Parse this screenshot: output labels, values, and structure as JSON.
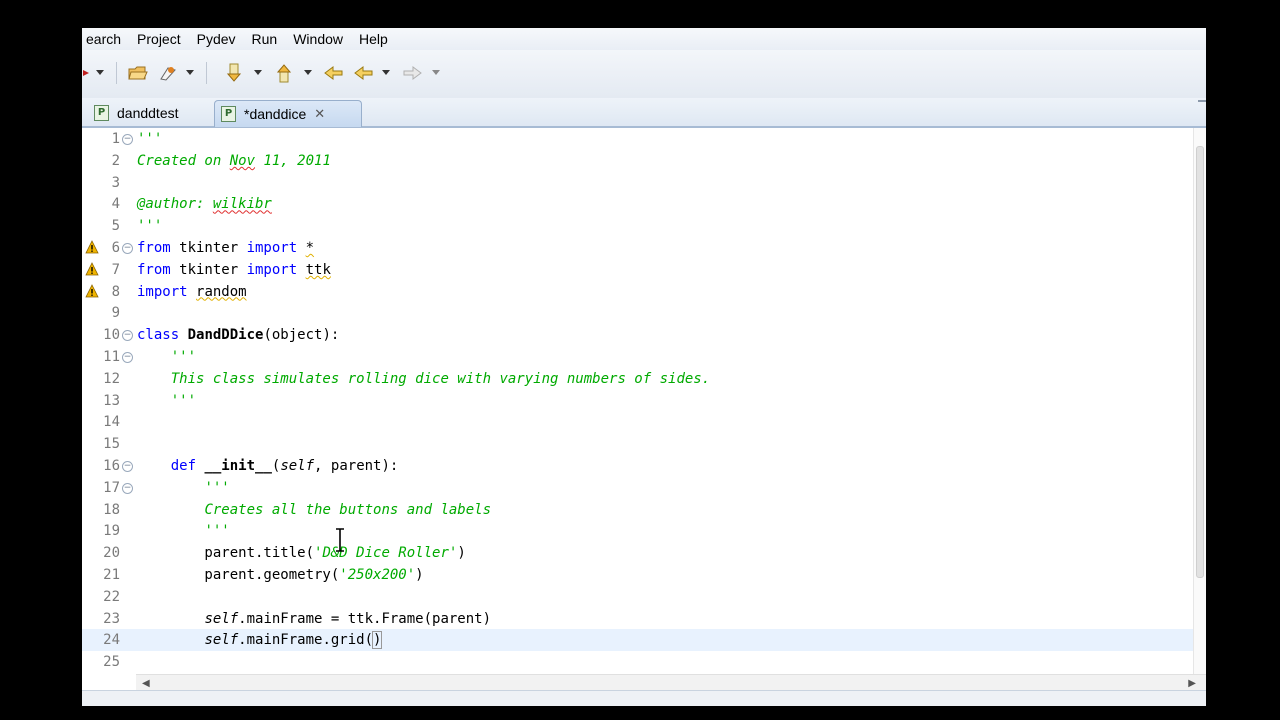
{
  "menu": [
    "earch",
    "Project",
    "Pydev",
    "Run",
    "Window",
    "Help"
  ],
  "tabs": [
    {
      "label": "danddtest",
      "icon": "pydev-file-icon",
      "active": false
    },
    {
      "label": "*danddice",
      "icon": "pydev-file-icon",
      "active": true
    }
  ],
  "tab_close_glyph": "✕",
  "colors": {
    "keyword": "#0000ff",
    "docstring": "#00aa00",
    "current_line": "#e8f2fe",
    "warning": "#f0b400"
  },
  "lines": [
    {
      "n": "1",
      "fold": true,
      "warn": false,
      "html": "<span class='doc'>'''</span>"
    },
    {
      "n": "2",
      "fold": false,
      "warn": false,
      "html": "<span class='doc'>Created on <span class='squig-red'>Nov</span> 11, 2011</span>"
    },
    {
      "n": "3",
      "fold": false,
      "warn": false,
      "html": ""
    },
    {
      "n": "4",
      "fold": false,
      "warn": false,
      "html": "<span class='doc'>@author: <span class='squig-red'>wilkibr</span></span>"
    },
    {
      "n": "5",
      "fold": false,
      "warn": false,
      "html": "<span class='doc'>'''</span>"
    },
    {
      "n": "6",
      "fold": true,
      "warn": true,
      "html": "<span class='kw'>from</span> tkinter <span class='kw'>import</span> <span class='squig'>*</span>"
    },
    {
      "n": "7",
      "fold": false,
      "warn": true,
      "html": "<span class='kw'>from</span> tkinter <span class='kw'>import</span> <span class='squig'>ttk</span>"
    },
    {
      "n": "8",
      "fold": false,
      "warn": true,
      "html": "<span class='kw'>import</span> <span class='squig'>random</span>"
    },
    {
      "n": "9",
      "fold": false,
      "warn": false,
      "html": ""
    },
    {
      "n": "10",
      "fold": true,
      "warn": false,
      "html": "<span class='kw'>class</span> <span class='cls'>DandDDice</span>(object):"
    },
    {
      "n": "11",
      "fold": true,
      "warn": false,
      "html": "    <span class='doc'>'''</span>"
    },
    {
      "n": "12",
      "fold": false,
      "warn": false,
      "html": "    <span class='doc'>This class simulates rolling dice with varying numbers of sides.</span>"
    },
    {
      "n": "13",
      "fold": false,
      "warn": false,
      "html": "    <span class='doc'>'''</span>"
    },
    {
      "n": "14",
      "fold": false,
      "warn": false,
      "html": ""
    },
    {
      "n": "15",
      "fold": false,
      "warn": false,
      "html": ""
    },
    {
      "n": "16",
      "fold": true,
      "warn": false,
      "html": "    <span class='kw'>def</span> <span class='cls'>__init__</span>(<span class='self'>self</span>, parent):"
    },
    {
      "n": "17",
      "fold": true,
      "warn": false,
      "html": "        <span class='doc'>'''</span>"
    },
    {
      "n": "18",
      "fold": false,
      "warn": false,
      "html": "        <span class='doc'>Creates all the buttons and labels</span>"
    },
    {
      "n": "19",
      "fold": false,
      "warn": false,
      "html": "        <span class='doc'>'''</span>"
    },
    {
      "n": "20",
      "fold": false,
      "warn": false,
      "html": "        parent.title(<span class='str'>'D&amp;D Dice Roller'</span>)"
    },
    {
      "n": "21",
      "fold": false,
      "warn": false,
      "html": "        parent.geometry(<span class='str'>'250x200'</span>)"
    },
    {
      "n": "22",
      "fold": false,
      "warn": false,
      "html": ""
    },
    {
      "n": "23",
      "fold": false,
      "warn": false,
      "html": "        <span class='self'>self</span>.mainFrame = ttk.Frame(parent)"
    },
    {
      "n": "24",
      "fold": false,
      "warn": false,
      "current": true,
      "html": "        <span class='self'>self</span>.mainFrame.grid(<span style='outline:1px solid #999'>)</span>"
    },
    {
      "n": "25",
      "fold": false,
      "warn": false,
      "html": ""
    }
  ]
}
